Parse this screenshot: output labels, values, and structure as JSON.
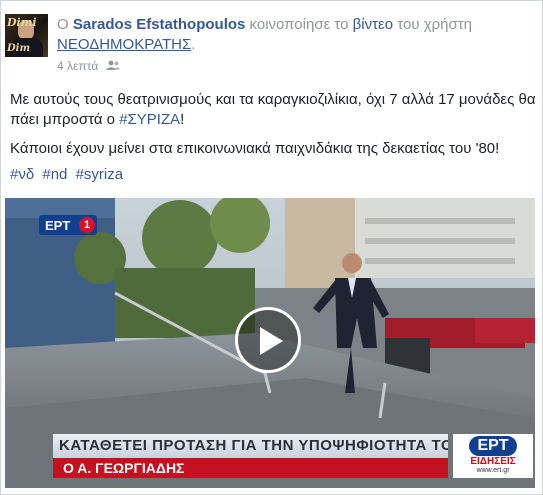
{
  "post": {
    "header": {
      "prefix": "Ο",
      "author": "Sarados Efstathopoulos",
      "shared_text": "κοινοποίησε το",
      "link_text": "βίντεο",
      "of_user": "του χρήστη",
      "page_name": "ΝΕΟΔΗΜΟΚΡΑΤΗΣ",
      "page_suffix": "."
    },
    "timestamp": "4 λεπτά",
    "privacy_icon": "friends-icon",
    "avatar_text_top": "Dimi",
    "avatar_text_bottom": "Dim",
    "body": {
      "line1_prefix": "Με αυτούς τους θεατρινισμούς και τα καραγκιοζιλίκια, όχι 7 αλλά 17 μονάδες θα πάει μπροστά ο ",
      "line1_hashtag": "#ΣΥΡΙΖΑ",
      "line1_suffix": "!",
      "line2": "Κάποιοι έχουν μείνει στα επικοινωνιακά παιχνιδάκια της δεκαετίας του '80!"
    },
    "hashtags": [
      "#νδ",
      "#nd",
      "#syriza"
    ]
  },
  "video": {
    "channel_badge": "ΕΡΤ",
    "channel_number": "1",
    "headline": "ΚΑΤΑΘΕΤΕΙ ΠΡΟΤΑΣΗ ΓΙΑ ΤΗΝ ΥΠΟΨΗΦΙΟΤΗΤΑ ΤΟΥ",
    "name": "Ο Α. ΓΕΩΡΓΙΑΔΗΣ",
    "logo_text": "ΕΡΤ",
    "logo_sub": "ΕΙΔΗΣΕΙΣ",
    "logo_url": "www.ert.gr",
    "play_icon": "play-icon"
  },
  "colors": {
    "link": "#365899",
    "meta": "#90949c",
    "ert_blue": "#0f3f8e",
    "ert_red": "#c4111f"
  }
}
